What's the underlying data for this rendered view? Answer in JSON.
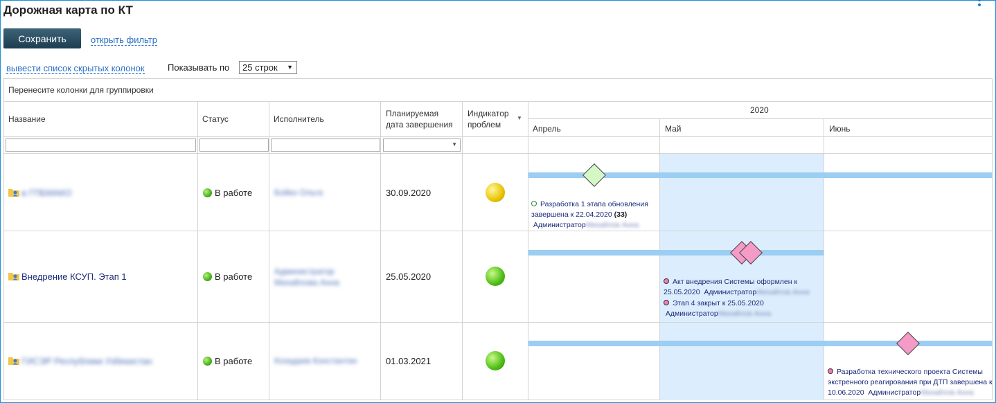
{
  "header": {
    "title": "Дорожная карта по КТ"
  },
  "toolbar": {
    "save_label": "Сохранить",
    "filter_link": "открыть фильтр",
    "hidden_columns_link": "вывести список скрытых колонок",
    "rows_label": "Показывать по",
    "rows_value": "25 строк"
  },
  "grid": {
    "group_hint": "Перенесите колонки для группировки",
    "columns": {
      "name": "Название",
      "status": "Статус",
      "assignee": "Исполнитель",
      "planned_date_1": "Планируемая",
      "planned_date_2": "дата завершения",
      "indicator_1": "Индикатор",
      "indicator_2": "проблем"
    },
    "timeline": {
      "year": "2020",
      "months": [
        "Апрель",
        "Май",
        "Июнь"
      ]
    },
    "rows": [
      {
        "name": "в ГПБМАКО",
        "status": "В работе",
        "assignee": "Бойко Ольга",
        "date": "30.09.2020",
        "indicator": "yellow",
        "notes": [
          {
            "text1": "Разработка 1 этапа обновления",
            "text2": "завершена к 22.04.2020",
            "count": "(33)",
            "author": "Администратор",
            "author_blur": "Михайлов Анна",
            "color": "green"
          }
        ]
      },
      {
        "name": "Внедрение КСУП. Этап 1",
        "status": "В работе",
        "assignee": "Администратор Михайлова Анна",
        "date": "25.05.2020",
        "indicator": "green",
        "notes": [
          {
            "text1": "Акт внедрения Системы оформлен к",
            "text2": "25.05.2020",
            "author": "Администратор",
            "author_blur": "Михайлов Анна",
            "color": "pink"
          },
          {
            "text1": "Этап 4 закрыт к 25.05.2020",
            "author": "Администратор",
            "author_blur": "Михайлов Анна",
            "color": "pink"
          }
        ]
      },
      {
        "name": "ГИСЭР Республики Узбекистан",
        "status": "В работе",
        "assignee": "Козадаев Константин",
        "date": "01.03.2021",
        "indicator": "green",
        "notes": [
          {
            "text1": "Разработка технического проекта Системы",
            "text2": "экстренного реагирования при ДТП завершена к",
            "text3": "10.06.2020",
            "author": "Администратор",
            "author_blur": "Михайлов Анна",
            "color": "pink"
          }
        ]
      }
    ]
  },
  "colors": {
    "accent": "#1e90d6",
    "bar": "#9ccdf3",
    "may_highlight": "#dceefd",
    "diamond_green": "#d4f7c6",
    "diamond_pink": "#f59bc8"
  }
}
